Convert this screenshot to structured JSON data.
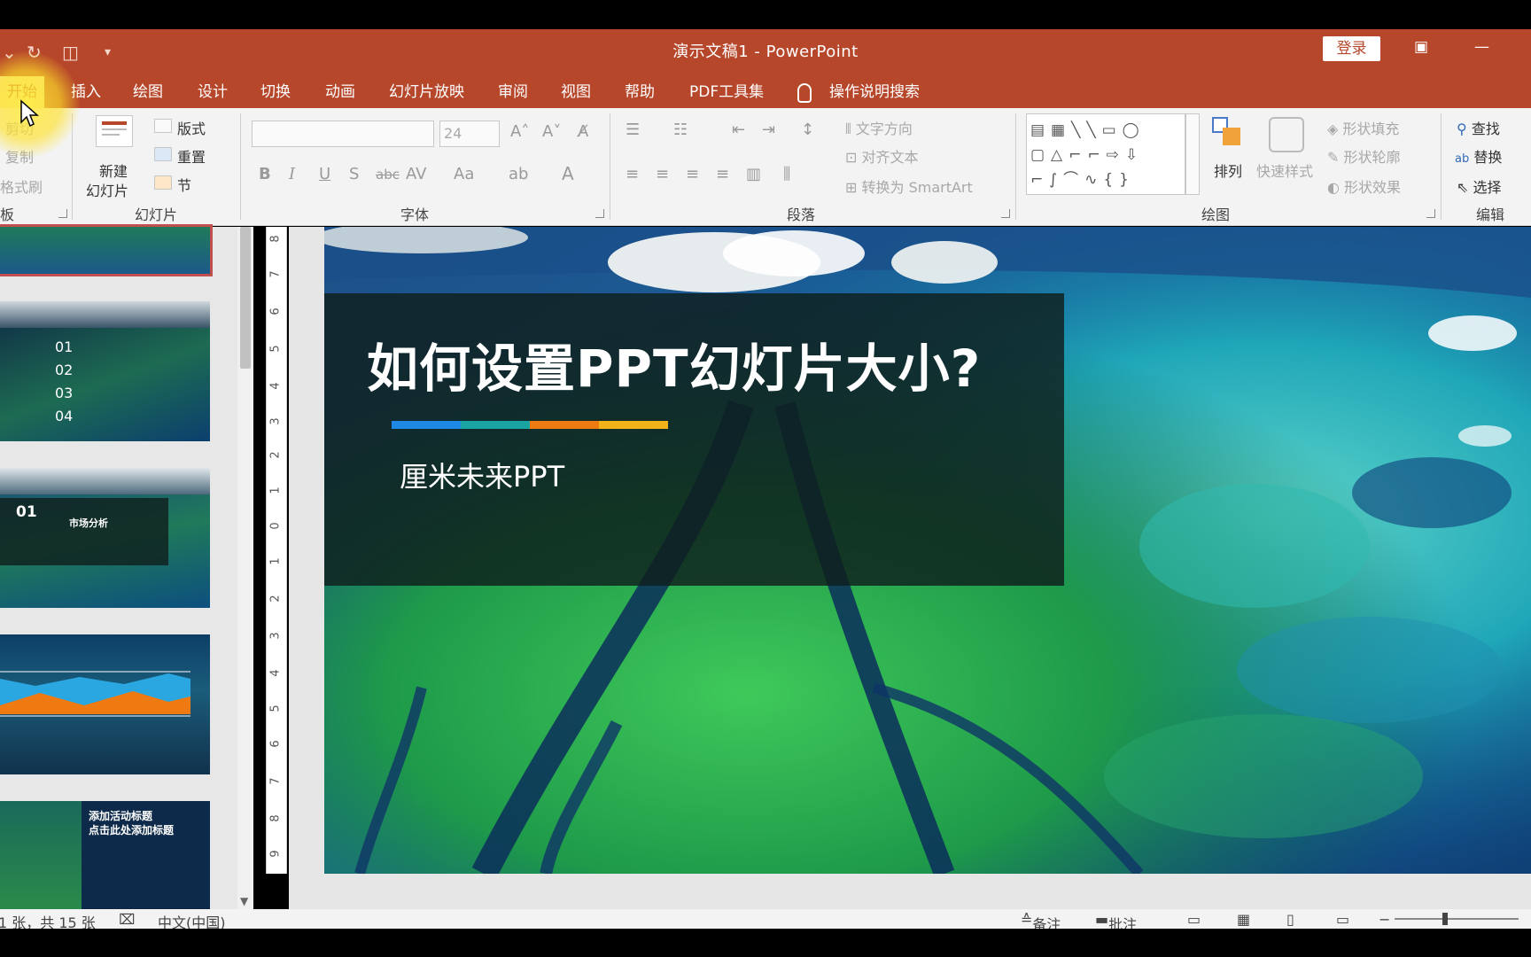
{
  "window": {
    "title": "演示文稿1  -  PowerPoint",
    "login_label": "登录"
  },
  "tabs": [
    {
      "label": "开始",
      "active": true
    },
    {
      "label": "插入"
    },
    {
      "label": "绘图"
    },
    {
      "label": "设计"
    },
    {
      "label": "切换"
    },
    {
      "label": "动画"
    },
    {
      "label": "幻灯片放映"
    },
    {
      "label": "审阅"
    },
    {
      "label": "视图"
    },
    {
      "label": "帮助"
    },
    {
      "label": "PDF工具集"
    }
  ],
  "tell_me": "操作说明搜索",
  "ribbon": {
    "clipboard": {
      "cut": "剪切",
      "copy": "复制",
      "format_painter": "格式刷",
      "group": "板"
    },
    "slides": {
      "new_slide_line1": "新建",
      "new_slide_line2": "幻灯片",
      "layout": "版式",
      "reset": "重置",
      "section": "节",
      "group": "幻灯片"
    },
    "font": {
      "font_size": "24",
      "group": "字体",
      "bold": "B",
      "italic": "I",
      "underline": "U",
      "shadow": "S",
      "strike": "abc",
      "case": "Aa",
      "color": "A"
    },
    "paragraph": {
      "text_direction": "文字方向",
      "align_text": "对齐文本",
      "smartart": "转换为 SmartArt",
      "group": "段落"
    },
    "drawing": {
      "arrange": "排列",
      "quick_styles": "快速样式",
      "shape_fill": "形状填充",
      "shape_outline": "形状轮廓",
      "shape_effects": "形状效果",
      "group": "绘图"
    },
    "editing": {
      "find": "查找",
      "replace": "替换",
      "select": "选择",
      "group": "编辑"
    }
  },
  "thumbnails": [
    {
      "items": [
        "01",
        "02",
        "03",
        "04"
      ]
    },
    {
      "number": "01",
      "heading": "市场分析"
    },
    {},
    {
      "heading_line1": "添加活动标题",
      "heading_line2": "点击此处添加标题"
    }
  ],
  "ruler_numbers": [
    "8",
    "7",
    "6",
    "5",
    "4",
    "3",
    "2",
    "1",
    "0",
    "1",
    "2",
    "3",
    "4",
    "5",
    "6",
    "7",
    "8",
    "9"
  ],
  "slide": {
    "title": "如何设置PPT幻灯片大小?",
    "subtitle": "厘米未来PPT",
    "bar_colors": [
      "#1e88e5",
      "#1aa3a3",
      "#f07a12",
      "#f2b21a"
    ]
  },
  "status": {
    "slide_info": "1 张，共 15 张",
    "language": "中文(中国)",
    "notes": "备注",
    "comments": "批注"
  }
}
